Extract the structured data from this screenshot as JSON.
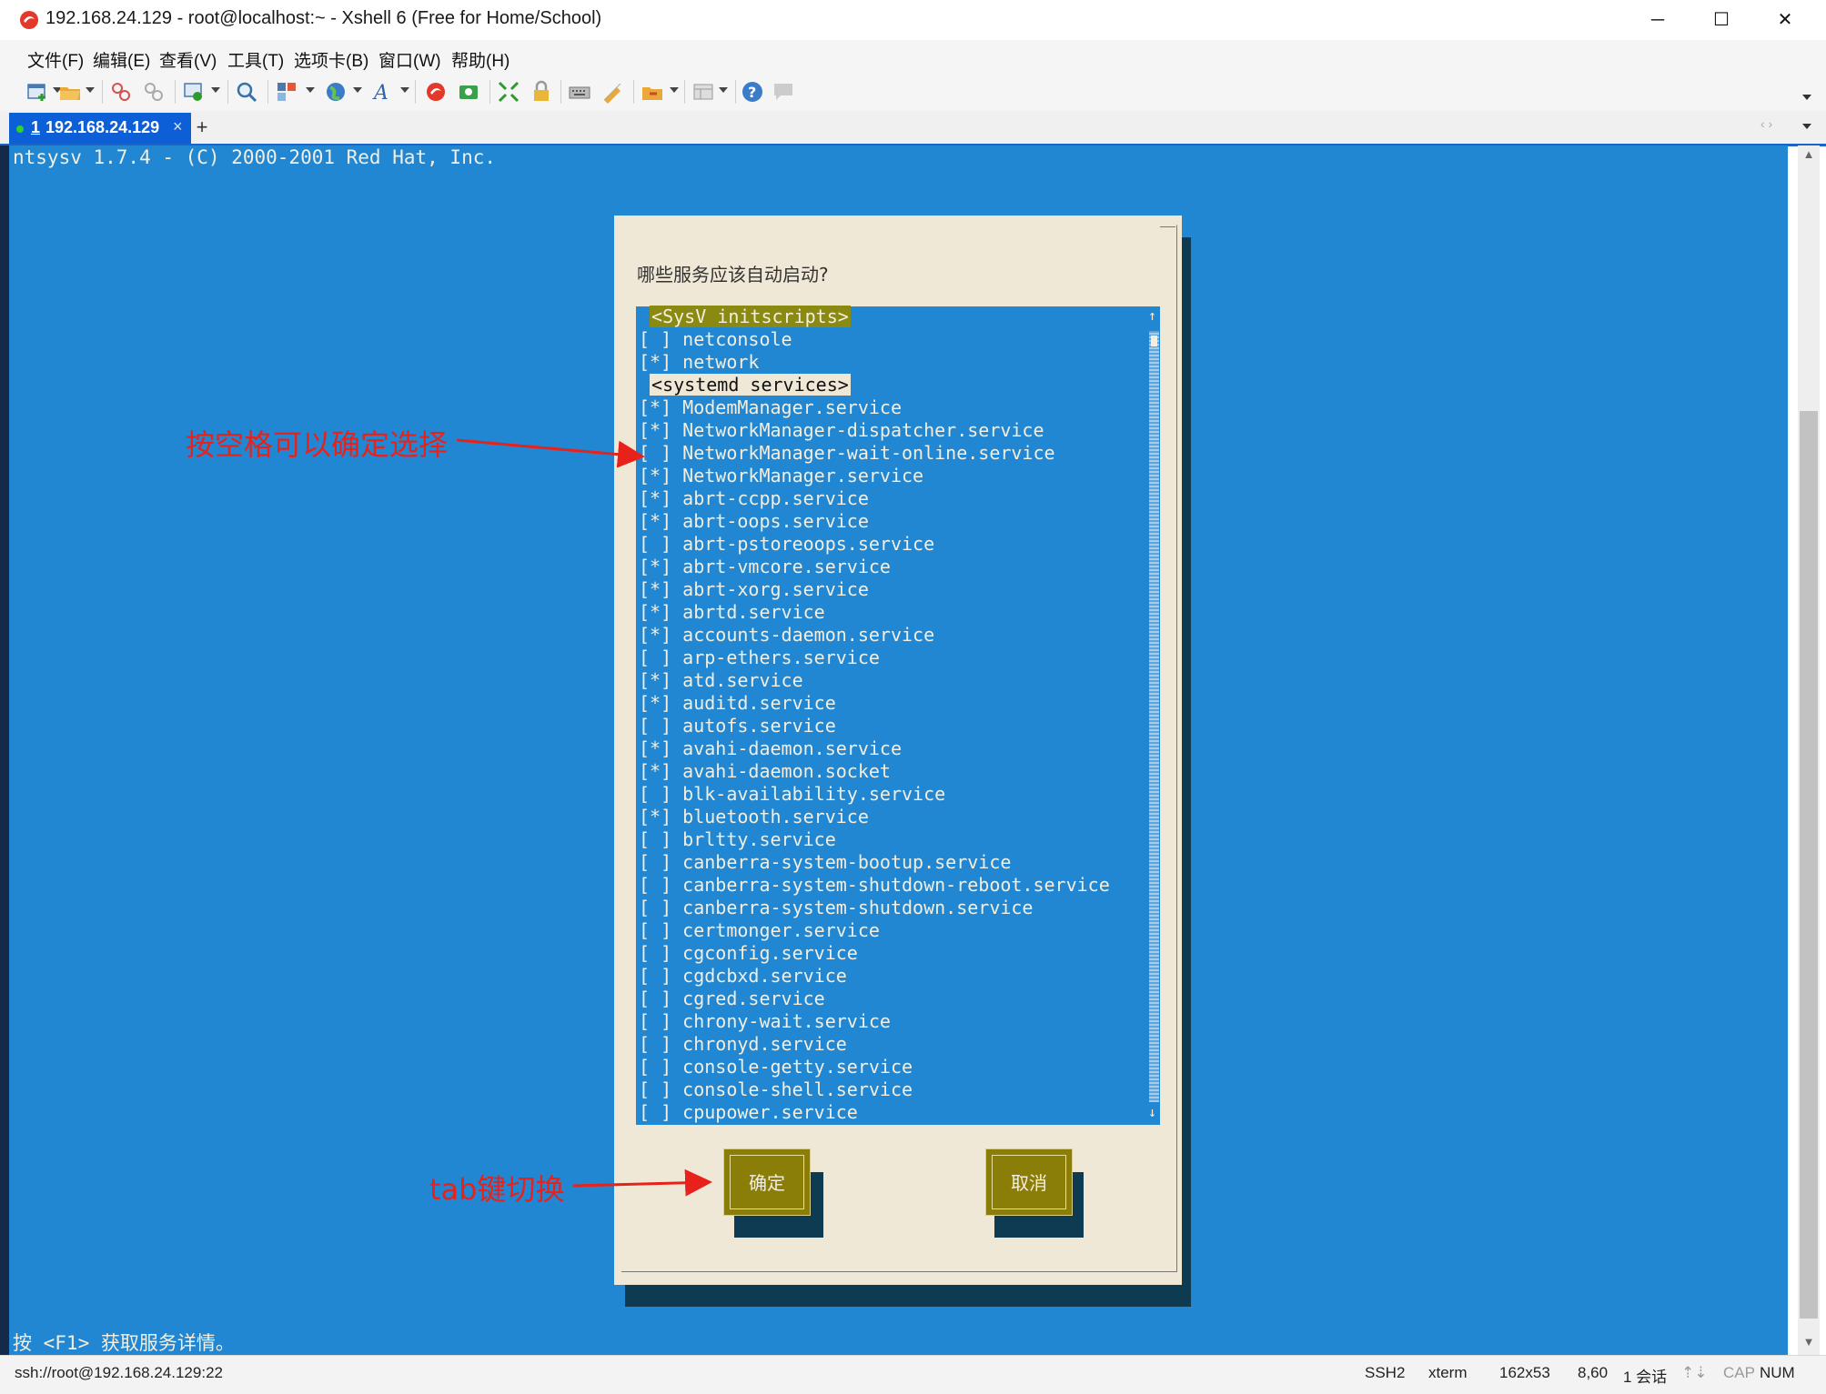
{
  "window": {
    "title": "192.168.24.129 - root@localhost:~ - Xshell 6 (Free for Home/School)",
    "minimize": "─",
    "maximize": "☐",
    "close": "✕"
  },
  "menu": [
    {
      "label": "文件(F)"
    },
    {
      "label": "编辑(E)"
    },
    {
      "label": "查看(V)"
    },
    {
      "label": "工具(T)"
    },
    {
      "label": "选项卡(B)"
    },
    {
      "label": "窗口(W)"
    },
    {
      "label": "帮助(H)"
    }
  ],
  "tabs": {
    "active": {
      "number": "1",
      "label": "192.168.24.129",
      "close": "×"
    },
    "new_tab": "+",
    "nav": "‹ ›"
  },
  "terminal": {
    "header": "ntsysv 1.7.4 - (C) 2000-2001 Red Hat, Inc.",
    "footer": "按 <F1> 获取服务详情。"
  },
  "dialog": {
    "prompt": "哪些服务应该自动启动?",
    "rows": [
      {
        "text": "<SysV initscripts>",
        "type": "header"
      },
      {
        "text": "[ ] netconsole",
        "type": "item"
      },
      {
        "text": "[*] network",
        "type": "item"
      },
      {
        "text": "<systemd services>",
        "type": "header-selected"
      },
      {
        "text": "[*] ModemManager.service",
        "type": "item"
      },
      {
        "text": "[*] NetworkManager-dispatcher.service",
        "type": "item"
      },
      {
        "text": "[ ] NetworkManager-wait-online.service",
        "type": "item"
      },
      {
        "text": "[*] NetworkManager.service",
        "type": "item"
      },
      {
        "text": "[*] abrt-ccpp.service",
        "type": "item"
      },
      {
        "text": "[*] abrt-oops.service",
        "type": "item"
      },
      {
        "text": "[ ] abrt-pstoreoops.service",
        "type": "item"
      },
      {
        "text": "[*] abrt-vmcore.service",
        "type": "item"
      },
      {
        "text": "[*] abrt-xorg.service",
        "type": "item"
      },
      {
        "text": "[*] abrtd.service",
        "type": "item"
      },
      {
        "text": "[*] accounts-daemon.service",
        "type": "item"
      },
      {
        "text": "[ ] arp-ethers.service",
        "type": "item"
      },
      {
        "text": "[*] atd.service",
        "type": "item"
      },
      {
        "text": "[*] auditd.service",
        "type": "item"
      },
      {
        "text": "[ ] autofs.service",
        "type": "item"
      },
      {
        "text": "[*] avahi-daemon.service",
        "type": "item"
      },
      {
        "text": "[*] avahi-daemon.socket",
        "type": "item"
      },
      {
        "text": "[ ] blk-availability.service",
        "type": "item"
      },
      {
        "text": "[*] bluetooth.service",
        "type": "item"
      },
      {
        "text": "[ ] brltty.service",
        "type": "item"
      },
      {
        "text": "[ ] canberra-system-bootup.service",
        "type": "item"
      },
      {
        "text": "[ ] canberra-system-shutdown-reboot.service",
        "type": "item"
      },
      {
        "text": "[ ] canberra-system-shutdown.service",
        "type": "item"
      },
      {
        "text": "[ ] certmonger.service",
        "type": "item"
      },
      {
        "text": "[ ] cgconfig.service",
        "type": "item"
      },
      {
        "text": "[ ] cgdcbxd.service",
        "type": "item"
      },
      {
        "text": "[ ] cgred.service",
        "type": "item"
      },
      {
        "text": "[ ] chrony-wait.service",
        "type": "item"
      },
      {
        "text": "[ ] chronyd.service",
        "type": "item"
      },
      {
        "text": "[ ] console-getty.service",
        "type": "item"
      },
      {
        "text": "[ ] console-shell.service",
        "type": "item"
      },
      {
        "text": "[ ] cpupower.service",
        "type": "item"
      }
    ],
    "scroll_up": "↑",
    "scroll_down": "↓",
    "ok_label": "确定",
    "cancel_label": "取消"
  },
  "annotations": {
    "space_hint": "按空格可以确定选择",
    "tab_hint": "tab键切换",
    "color": "#e8211b"
  },
  "status": {
    "connection": "ssh://root@192.168.24.129:22",
    "protocol": "SSH2",
    "term": "xterm",
    "size": "162x53",
    "cursor": "8,60",
    "sessions": "1 会话",
    "cap": "CAP",
    "num": "NUM"
  },
  "colors": {
    "terminal_bg": "#2287d2",
    "dialog_bg": "#f0e8d6",
    "button_bg": "#8a7d08",
    "tab_active": "#0c5fd6"
  }
}
